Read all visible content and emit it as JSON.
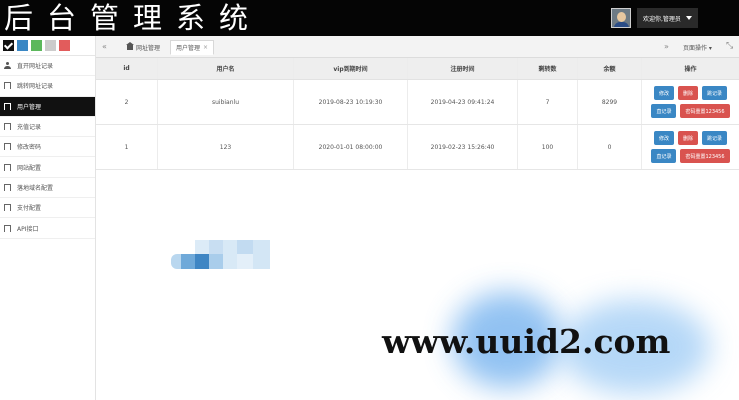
{
  "header": {
    "logo_text": "后台管理系统",
    "user_label": "欢迎你,管理员"
  },
  "sidebar": {
    "swatch_colors": [
      "#111111",
      "#3a87c4",
      "#5cb85c",
      "#cccccc",
      "#e25c5c"
    ],
    "items": [
      {
        "label": "直开网址记录",
        "icon": "user-icon",
        "active": false
      },
      {
        "label": "跳转网址记录",
        "icon": "bookmark-icon",
        "active": false
      },
      {
        "label": "用户管理",
        "icon": "bookmark-icon",
        "active": true
      },
      {
        "label": "充值记录",
        "icon": "bookmark-icon",
        "active": false
      },
      {
        "label": "修改密码",
        "icon": "bookmark-icon",
        "active": false
      },
      {
        "label": "网站配置",
        "icon": "bookmark-icon",
        "active": false
      },
      {
        "label": "落地域名配置",
        "icon": "bookmark-icon",
        "active": false
      },
      {
        "label": "支付配置",
        "icon": "bookmark-icon",
        "active": false
      },
      {
        "label": "API接口",
        "icon": "bookmark-icon",
        "active": false
      }
    ]
  },
  "tabs": {
    "home_label": "网址管理",
    "active_label": "用户管理",
    "close_symbol": "×",
    "page_ops_label": "页面操作 ▾"
  },
  "table": {
    "columns": [
      "id",
      "用户名",
      "vip到期时间",
      "注册时间",
      "剩转数",
      "余额",
      "操作"
    ],
    "rows": [
      {
        "id": "2",
        "username": "suibianlu",
        "vip_expire": "2019-08-23 10:19:30",
        "register_time": "2019-04-23 09:41:24",
        "count": "7",
        "balance": "8299"
      },
      {
        "id": "1",
        "username": "123",
        "vip_expire": "2020-01-01 08:00:00",
        "register_time": "2019-02-23 15:26:40",
        "count": "100",
        "balance": "0"
      }
    ],
    "actions": {
      "edit": "修改",
      "delete": "删除",
      "jump_log": "跳记录",
      "direct_log": "直记录",
      "reset_password": "密码重置123456"
    }
  },
  "colors": {
    "header_bg": "#050505",
    "active_menu_bg": "#111111",
    "button_blue": "#3a87c4",
    "button_red": "#d9534f"
  },
  "watermark": {
    "text": "www.uuid2.com"
  }
}
